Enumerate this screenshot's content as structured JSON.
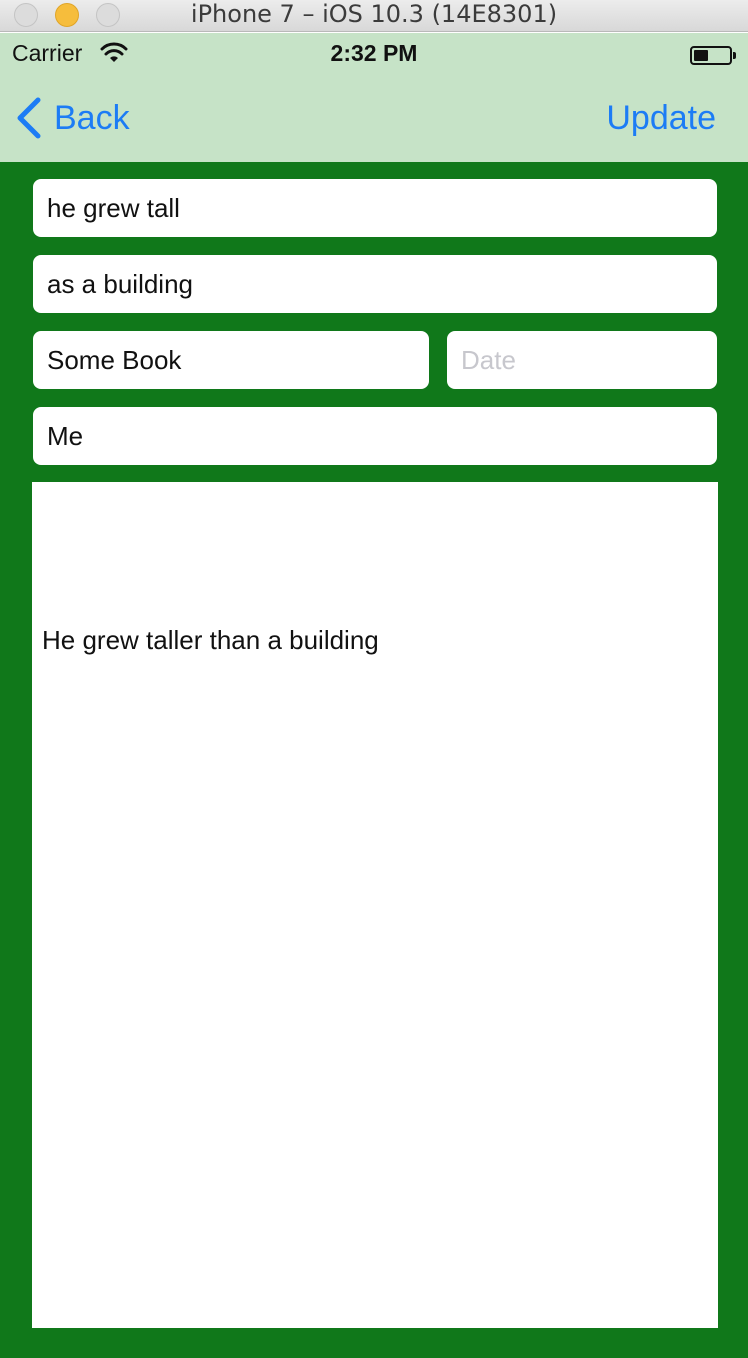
{
  "window": {
    "title": "iPhone 7 – iOS 10.3 (14E8301)"
  },
  "status_bar": {
    "carrier": "Carrier",
    "time": "2:32 PM",
    "wifi_icon": "wifi-icon",
    "battery_icon": "battery-icon"
  },
  "nav": {
    "back_label": "Back",
    "back_icon": "chevron-left-icon",
    "update_label": "Update"
  },
  "form": {
    "field1_value": "he grew tall",
    "field2_value": "as a building",
    "book_value": "Some Book",
    "date_placeholder": "Date",
    "author_value": "Me",
    "body_text": "He grew taller than a building"
  },
  "colors": {
    "background_green": "#10781a",
    "nav_bar": "#c6e3c7",
    "tint": "#1c7cf5"
  }
}
